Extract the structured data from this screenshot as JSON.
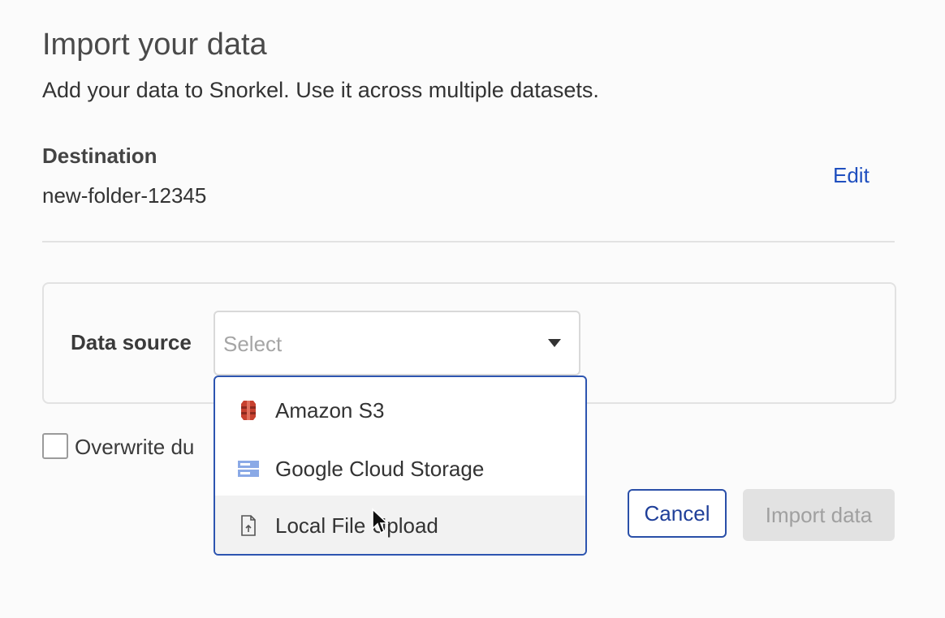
{
  "header": {
    "title": "Import your data",
    "subtitle": "Add your data to Snorkel. Use it across multiple datasets."
  },
  "destination": {
    "label": "Destination",
    "value": "new-folder-12345",
    "edit_label": "Edit"
  },
  "data_source": {
    "label": "Data source",
    "placeholder": "Select",
    "options": [
      {
        "label": "Amazon S3",
        "icon": "amazon-s3-icon"
      },
      {
        "label": "Google Cloud Storage",
        "icon": "google-cloud-storage-icon"
      },
      {
        "label": "Local File Upload",
        "icon": "file-upload-icon"
      }
    ],
    "hovered_option": "Local File Upload"
  },
  "overwrite": {
    "label": "Overwrite du",
    "checked": false
  },
  "actions": {
    "cancel_label": "Cancel",
    "import_label": "Import data"
  },
  "colors": {
    "accent": "#1f4fbf",
    "dropdown_border": "#2d55b0",
    "disabled_bg": "#e2e2e2",
    "disabled_text": "#a0a0a0",
    "s3_red": "#c7412f",
    "gcs_blue": "#8aa9e6"
  }
}
